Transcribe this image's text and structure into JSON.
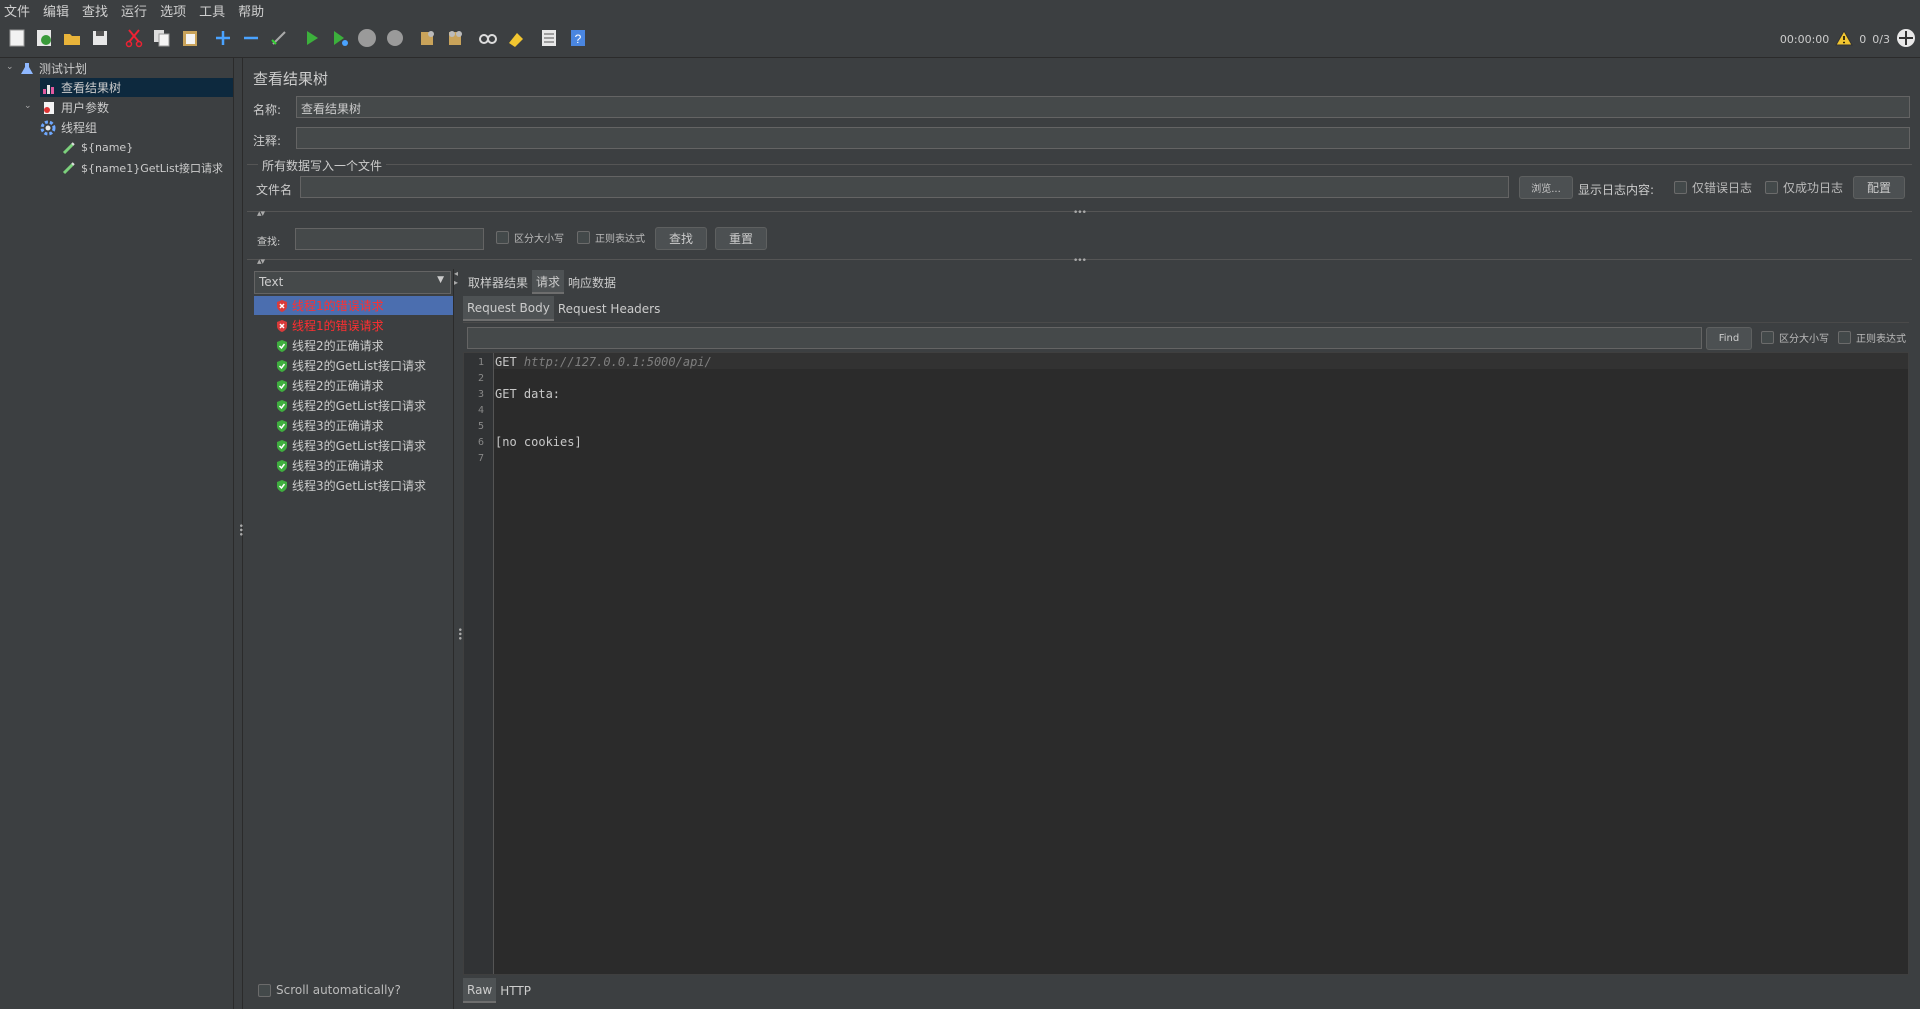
{
  "menubar": {
    "items": [
      "文件",
      "编辑",
      "查找",
      "运行",
      "选项",
      "工具",
      "帮助"
    ]
  },
  "toolbar": {
    "buttons": [
      "new-icon",
      "templates-icon",
      "open-icon",
      "save-icon",
      "cut-icon",
      "copy-icon",
      "paste-icon",
      "expand-icon",
      "collapse-icon",
      "toggle-icon",
      "start-icon",
      "start-no-pause-icon",
      "stop-icon",
      "shutdown-icon",
      "clear-icon",
      "clear-all-icon",
      "search-icon",
      "reset-search-icon",
      "function-helper-icon",
      "help-icon"
    ],
    "timer": "00:00:00",
    "warning_count": "0",
    "threads": "0/3"
  },
  "tree": {
    "items": [
      {
        "label": "测试计划",
        "icon": "flask-icon"
      },
      {
        "label": "查看结果树",
        "icon": "chart-icon"
      },
      {
        "label": "用户参数",
        "icon": "document-icon"
      },
      {
        "label": "线程组",
        "icon": "gear-icon"
      },
      {
        "label": "${name}",
        "icon": "pipette-icon"
      },
      {
        "label": "${name1}GetList接口请求",
        "icon": "pipette-icon"
      }
    ]
  },
  "panel": {
    "title": "查看结果树",
    "name_label": "名称:",
    "name_value": "查看结果树",
    "comment_label": "注释:",
    "comment_value": "",
    "file_group_label": "所有数据写入一个文件",
    "filename_label": "文件名",
    "filename_value": "",
    "browse_button": "浏览...",
    "log_label": "显示日志内容:",
    "errors_only": "仅错误日志",
    "success_only": "仅成功日志",
    "configure_button": "配置",
    "search_label": "查找:",
    "search_value": "",
    "case_sensitive": "区分大小写",
    "regex": "正则表达式",
    "find_button": "查找",
    "reset_button": "重置"
  },
  "results": {
    "renderer": "Text",
    "items": [
      {
        "label": "线程1的错误请求",
        "status": "error"
      },
      {
        "label": "线程1的错误请求",
        "status": "error"
      },
      {
        "label": "线程2的正确请求",
        "status": "success"
      },
      {
        "label": "线程2的GetList接口请求",
        "status": "success"
      },
      {
        "label": "线程2的正确请求",
        "status": "success"
      },
      {
        "label": "线程2的GetList接口请求",
        "status": "success"
      },
      {
        "label": "线程3的正确请求",
        "status": "success"
      },
      {
        "label": "线程3的GetList接口请求",
        "status": "success"
      },
      {
        "label": "线程3的正确请求",
        "status": "success"
      },
      {
        "label": "线程3的GetList接口请求",
        "status": "success"
      }
    ],
    "scroll_auto": "Scroll automatically?"
  },
  "detail": {
    "tabs": [
      "取样器结果",
      "请求",
      "响应数据"
    ],
    "active_tab": "请求",
    "subtabs": [
      "Request Body",
      "Request Headers"
    ],
    "find_value": "",
    "find_button": "Find",
    "case_sensitive": "区分大小写",
    "regex": "正则表达式",
    "lines": [
      {
        "num": "1",
        "prefix": "GET ",
        "url": "http://127.0.0.1:5000/api/"
      },
      {
        "num": "2",
        "prefix": "",
        "url": ""
      },
      {
        "num": "3",
        "prefix": "GET data:",
        "url": ""
      },
      {
        "num": "4",
        "prefix": "",
        "url": ""
      },
      {
        "num": "5",
        "prefix": "",
        "url": ""
      },
      {
        "num": "6",
        "prefix": "[no cookies]",
        "url": ""
      },
      {
        "num": "7",
        "prefix": "",
        "url": ""
      }
    ],
    "bottom_tabs": [
      "Raw",
      "HTTP"
    ]
  },
  "colors": {
    "error_text": "#ff3030",
    "selection": "#4b6eaf",
    "success_icon": "#3fae3f",
    "error_icon": "#d93b3b"
  }
}
